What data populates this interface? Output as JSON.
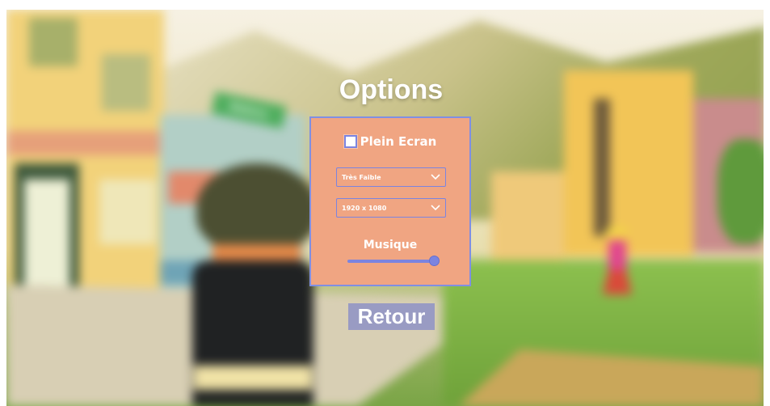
{
  "menu": {
    "title": "Options",
    "fullscreen": {
      "label": "Plein Ecran",
      "checked": false
    },
    "quality_dropdown": {
      "selected": "Très Faible"
    },
    "resolution_dropdown": {
      "selected": "1920 x 1080"
    },
    "music": {
      "label": "Musique",
      "volume_percent": 100
    },
    "back_button_label": "Retour"
  },
  "background": {
    "shop_sign": "Bakery"
  },
  "colors": {
    "panel": "#f0a582",
    "accent": "#7b84e0",
    "text": "#ffffff"
  }
}
